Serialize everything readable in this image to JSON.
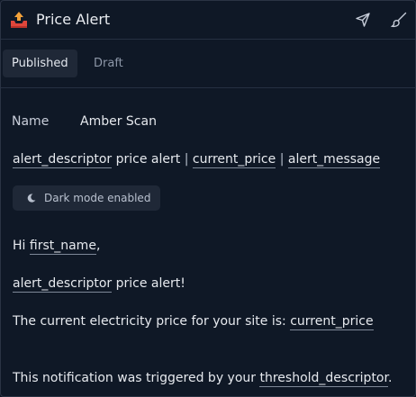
{
  "header": {
    "title": "Price Alert"
  },
  "tabs": [
    {
      "label": "Published",
      "active": true
    },
    {
      "label": "Draft",
      "active": false
    }
  ],
  "fields": {
    "name_label": "Name",
    "name_value": "Amber Scan"
  },
  "subject": {
    "var1": "alert_descriptor",
    "text1": " price alert ",
    "sep1": "|",
    "var2": "current_price",
    "sep2": "|",
    "var3": "alert_message"
  },
  "dark_mode_label": "Dark mode enabled",
  "body": {
    "greeting_prefix": "Hi ",
    "greeting_var": "first_name",
    "greeting_suffix": ",",
    "alert_var": "alert_descriptor",
    "alert_text": " price alert!",
    "price_text": "The current electricity price for your site is: ",
    "price_var": "current_price",
    "trigger_text": "This notification was triggered by your ",
    "trigger_var": "threshold_descriptor",
    "trigger_suffix": "."
  },
  "icons": {
    "app": "outbox-tray-icon",
    "send": "send-icon",
    "brush": "brush-icon",
    "moon": "moon-icon"
  },
  "colors": {
    "background": "#0f1826",
    "tab_active_bg": "#1f2837",
    "border": "#263042",
    "app_icon_tray": "#e0463b",
    "app_icon_arrow": "#f2a23a"
  }
}
